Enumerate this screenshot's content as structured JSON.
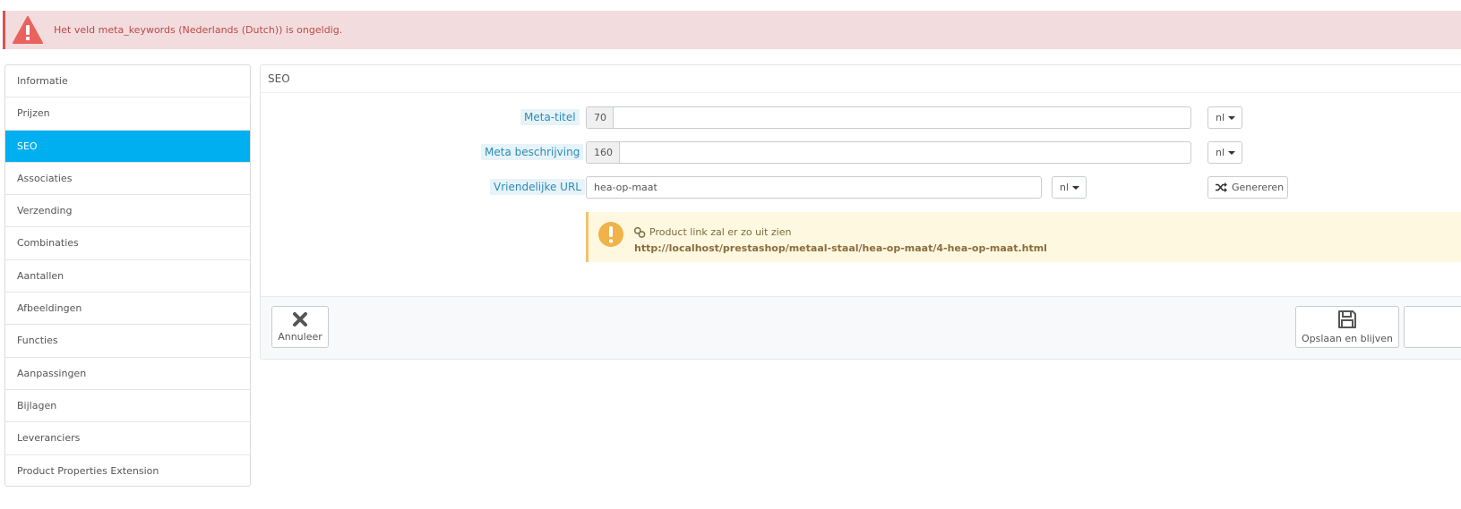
{
  "alert": {
    "message": "Het veld meta_keywords (Nederlands (Dutch)) is ongeldig.",
    "color": "#d9534f"
  },
  "sidebar": {
    "active_color": "#00aff0",
    "items": [
      {
        "label": "Informatie"
      },
      {
        "label": "Prijzen"
      },
      {
        "label": "SEO",
        "active": true
      },
      {
        "label": "Associaties"
      },
      {
        "label": "Verzending"
      },
      {
        "label": "Combinaties"
      },
      {
        "label": "Aantallen"
      },
      {
        "label": "Afbeeldingen"
      },
      {
        "label": "Functies"
      },
      {
        "label": "Aanpassingen"
      },
      {
        "label": "Bijlagen"
      },
      {
        "label": "Leveranciers"
      },
      {
        "label": "Product Properties Extension"
      }
    ]
  },
  "panel": {
    "title": "SEO",
    "meta_title": {
      "label": "Meta-titel",
      "counter": "70",
      "value": "",
      "lang": "nl"
    },
    "meta_description": {
      "label": "Meta beschrijving",
      "counter": "160",
      "value": "",
      "lang": "nl"
    },
    "friendly_url": {
      "label": "Vriendelijke URL",
      "value": "hea-op-maat",
      "lang": "nl",
      "generate_label": "Genereren"
    },
    "preview": {
      "caption": "Product link zal er zo uit zien",
      "url": "http://localhost/prestashop/metaal-staal/hea-op-maat/4-hea-op-maat.html"
    },
    "footer": {
      "cancel_label": "Annuleer",
      "save_stay_label": "Opslaan en blijven"
    }
  }
}
